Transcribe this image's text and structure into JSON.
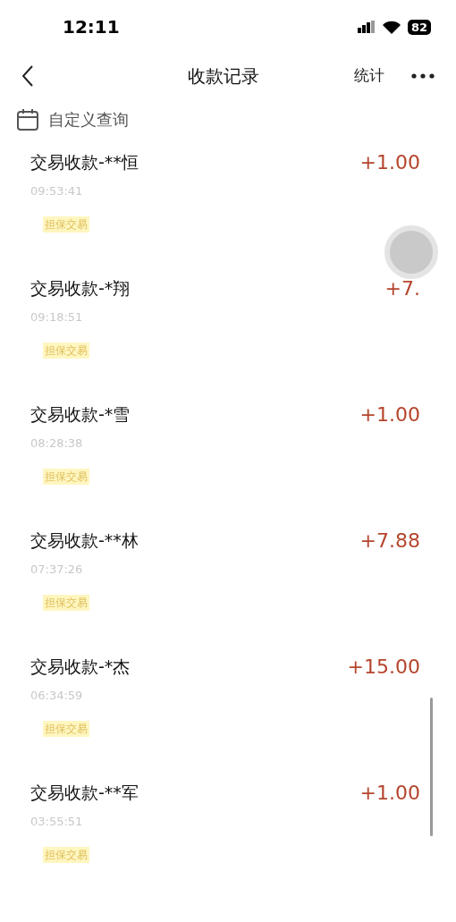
{
  "status_bar": {
    "time": "12:11",
    "battery": "82"
  },
  "nav": {
    "title": "收款记录",
    "action": "统计"
  },
  "filter": {
    "label": "自定义查询"
  },
  "records": [
    {
      "title": "交易收款-**恒",
      "time": "09:53:41",
      "tag": "担保交易",
      "amount": "+1.00"
    },
    {
      "title": "交易收款-*翔",
      "time": "09:18:51",
      "tag": "担保交易",
      "amount": "+7."
    },
    {
      "title": "交易收款-*雪",
      "time": "08:28:38",
      "tag": "担保交易",
      "amount": "+1.00"
    },
    {
      "title": "交易收款-**林",
      "time": "07:37:26",
      "tag": "担保交易",
      "amount": "+7.88"
    },
    {
      "title": "交易收款-*杰",
      "time": "06:34:59",
      "tag": "担保交易",
      "amount": "+15.00"
    },
    {
      "title": "交易收款-**军",
      "time": "03:55:51",
      "tag": "担保交易",
      "amount": "+1.00"
    }
  ]
}
